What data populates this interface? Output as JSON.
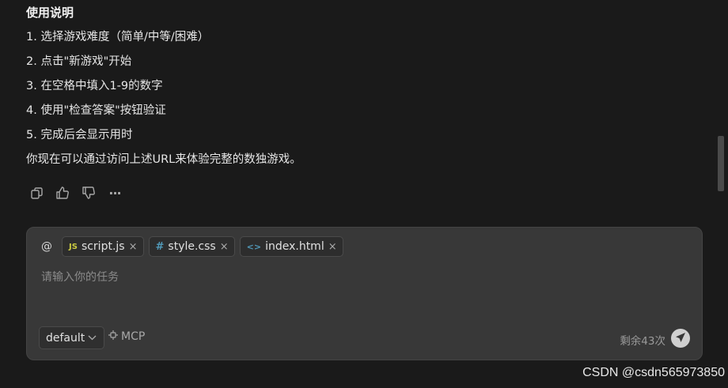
{
  "message": {
    "heading": "使用说明",
    "steps": [
      "1. 选择游戏难度（简单/中等/困难）",
      "2. 点击\"新游戏\"开始",
      "3. 在空格中填入1-9的数字",
      "4. 使用\"检查答案\"按钮验证",
      "5. 完成后会显示用时"
    ],
    "summary": "你现在可以通过访问上述URL来体验完整的数独游戏。"
  },
  "actions": {
    "icons": [
      "copy-icon",
      "thumbs-up-icon",
      "thumbs-down-icon",
      "more-icon"
    ],
    "more_glyph": "···"
  },
  "composer": {
    "at_label": "@",
    "context_files": [
      {
        "icon": "JS",
        "name": "script.js",
        "icon_name": "js-file-icon"
      },
      {
        "icon": "#",
        "name": "style.css",
        "icon_name": "css-file-icon"
      },
      {
        "icon": "<>",
        "name": "index.html",
        "icon_name": "html-file-icon"
      }
    ],
    "close_glyph": "×",
    "placeholder": "请输入你的任务",
    "mode": "default",
    "mcp_label": "MCP",
    "remaining": "剩余43次"
  },
  "watermark": "CSDN @csdn565973850",
  "colors": {
    "background": "#1a1a1a",
    "panel": "#383838",
    "js_icon": "#cbcb41",
    "css_icon": "#519aba",
    "send_button": "#d0d0d0"
  }
}
